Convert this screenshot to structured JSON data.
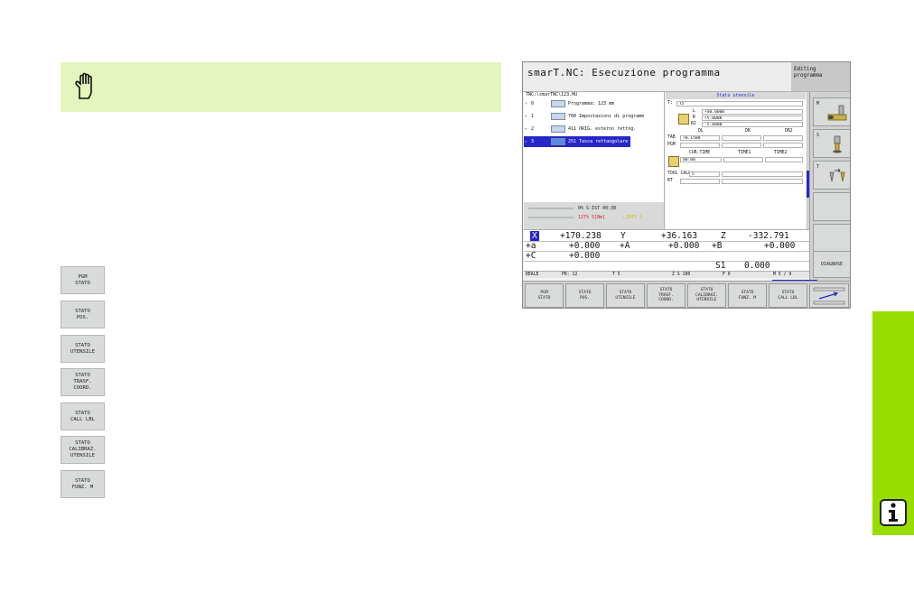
{
  "left_softkeys": [
    "PGM\nSTATO",
    "STATO\nPOS.",
    "STATO\nUTENSILE",
    "STATO\nTRASF.\nCOORD.",
    "STATO\nCALL LBL",
    "STATO\nCALIBRAZ.\nUTENSILE",
    "STATO\nFUNZ. M"
  ],
  "screen": {
    "title": "smarT.NC: Esecuzione programma",
    "mode": "Editing\nprogramma",
    "tree": {
      "path": "TNC:\\smarTNC\\123.HU",
      "rows": [
        {
          "twisty": "▿",
          "num": "0",
          "text": "Programma: 123 mm"
        },
        {
          "twisty": "▹",
          "num": "1",
          "text": "700 Impostazioni di programm"
        },
        {
          "twisty": "▹",
          "num": "2",
          "text": "411 ORIG. esterno rettng."
        },
        {
          "twisty": "▹",
          "num": "3",
          "text": "251 Tasca rettangolare"
        }
      ]
    },
    "progress": {
      "line1": "0%  S-IST  00:38",
      "line2": "127%  S[Nm]",
      "line2b": "LIMIT 1"
    },
    "tool_status": {
      "title": "Stato utensile",
      "t_label": "T:",
      "t_value": "T5",
      "l_label": "L",
      "l_value": "+40.0000",
      "r_label": "R",
      "r_value": "+5.0000",
      "r2_label": "R2",
      "r2_value": "-5.0000",
      "dl": "DL",
      "dr": "DR",
      "dr2": "DR2",
      "tab_label": "TAB",
      "tab_value": "+0.1500",
      "pgm_label": "PGM",
      "cur_time": "CUR.TIME",
      "time1": "TIME1",
      "time2": "TIME2",
      "cur_time_value": "00:00",
      "tool_call_label": "TOOL CALL",
      "tool_call_value": "5",
      "rt_label": "RT"
    },
    "positions": {
      "x_axis": "X",
      "x_val": "+170.238",
      "y_axis": "Y",
      "y_val": "+36.163",
      "z_axis": "Z",
      "z_val": "-332.791",
      "a_axis": "+a",
      "a_val": "+0.000",
      "ca_axis": "+A",
      "ca_val": "+0.000",
      "b_axis": "+B",
      "b_val": "+0.000",
      "c_axis": "+C",
      "c_val": "+0.000",
      "s_label": "S1",
      "s_val": "0.000"
    },
    "status_bar": {
      "mode": "REALE",
      "pr": "PR: 12",
      "t": "T 5",
      "z": "Z S 100",
      "f": "F 0",
      "m": "M 5 / 9"
    },
    "bottom_softkeys": [
      "PGM\nSTATO",
      "STATO\nPOS.",
      "STATO\nUTENSILE",
      "STATO\nTRASF.\nCOORD.",
      "STATO\nCALIBRAZ.\nUTENSILE",
      "STATO\nFUNZ. M",
      "STATO\nCALL LBL"
    ],
    "vertical_softkeys": {
      "m": "M",
      "s": "S",
      "t": "T",
      "diagnose": "DIAGNOSE"
    }
  },
  "colors": {
    "note_bg": "#e4f5bd",
    "side_tab": "#99dd00",
    "selection": "#2727c8"
  }
}
